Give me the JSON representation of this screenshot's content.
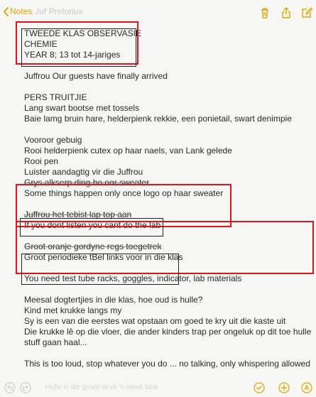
{
  "toolbar": {
    "back_label": "Notes",
    "ghost_title": "Juf Pretorius",
    "icons": [
      "chevron-left-icon",
      "trash-icon",
      "share-icon",
      "compose-icon"
    ],
    "accent_color": "#e2a400"
  },
  "note": {
    "lines": [
      "TWEEDE KLAS OBSERVASIE",
      "CHEMIE",
      "YEAR 8; 13 tot 14-jariges",
      "",
      "Juffrou Our guests have finally arrived",
      "",
      "PERS TRUITJIE",
      "Lang swart bootse met tossels",
      "Baie lamg bruin hare, helderpienk rekkie, een ponietail, swart denimpie",
      "",
      "Vooroor gebuig",
      "Rooi helderpienk cutex op haar naels, van Lank gelede",
      "Rooi pen",
      "Luister aandagtig vir die Juffrou",
      "Grys alkserp ding bo oor sweater",
      "Some things happen only once logo op haar sweater",
      "",
      "Juffrou het tebist lap top aan",
      "If you dont listen you cant do the lab",
      "",
      "Groot oranje gordyne regs toegetrek",
      "Groot periodieke tBel links voor in die klas",
      "",
      "You need test tube racks, goggles, indicator, lab materials",
      "",
      "Meesal dogtertjies in die klas, hoe oud is hulle?",
      "Kind met krukke langs my",
      "Sy is een van die eerstes wat opstaan om goed te kry uit die kaste uit",
      "Die krukke lê op die vloer, die ander kinders trap per ongeluk op dit toe hulle",
      "stuff gaan haal...",
      "",
      "This is too loud, stop whatever you do ... no talking, only whispering allowed"
    ]
  },
  "bottom": {
    "ghost_text": "Hulle is die groep al vir 'n week lank",
    "icons": [
      "undo-icon",
      "redo-icon",
      "checklist-icon",
      "add-icon",
      "markup-icon"
    ]
  },
  "annotation_colors": {
    "red": "#e0141b",
    "black": "#222222"
  }
}
